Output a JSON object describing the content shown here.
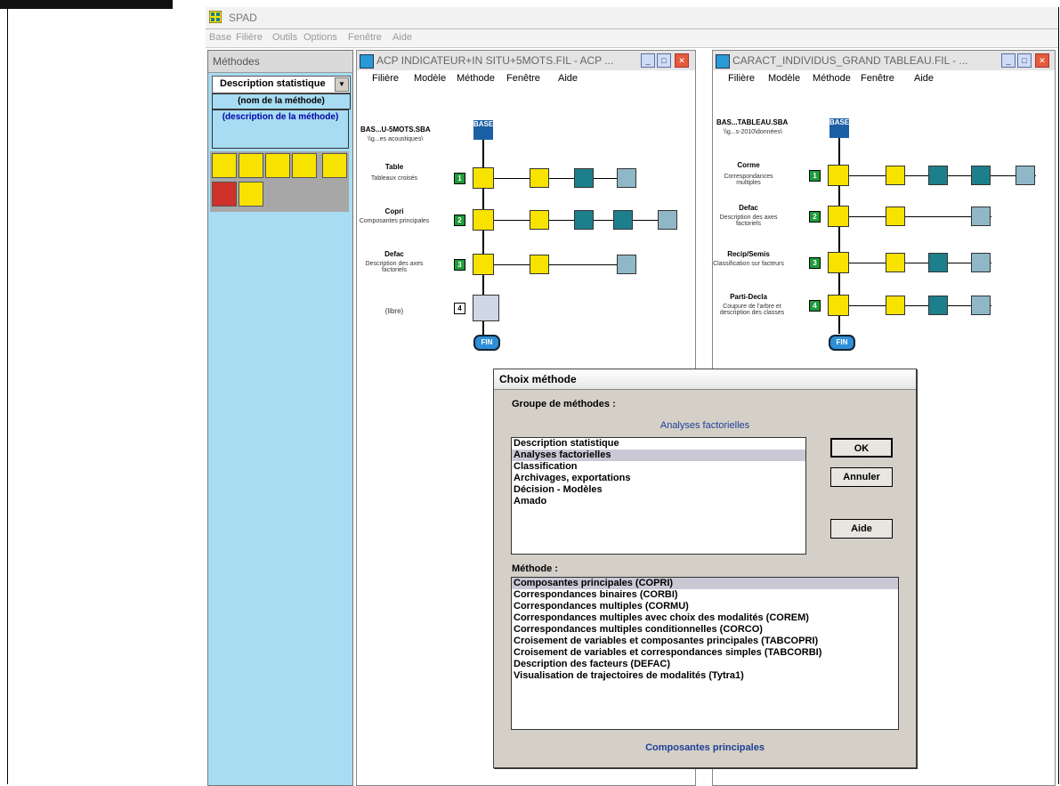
{
  "app": {
    "title": "SPAD"
  },
  "menubar": [
    "Base",
    "Filière",
    "Outils",
    "Options",
    "Fenêtre",
    "Aide"
  ],
  "methods_panel": {
    "title": "Méthodes",
    "combo_value": "Description statistique",
    "method_name": "(nom de la méthode)",
    "method_description": "(description de la méthode)"
  },
  "window1": {
    "title": "ACP INDICATEUR+IN SITU+5MOTS.FIL - ACP ...",
    "menu": [
      "Filière",
      "Modèle",
      "Méthode",
      "Fenêtre",
      "Aide"
    ],
    "base_name": "BAS...U-5MOTS.SBA",
    "base_path": "\\\\g...es acoustiques\\",
    "base_label": "BASE",
    "fin_label": "FIN",
    "steps": [
      {
        "num": "1",
        "name": "Table",
        "desc": "Tableaux croisés"
      },
      {
        "num": "2",
        "name": "Copri",
        "desc": "Composantes principales"
      },
      {
        "num": "3",
        "name": "Defac",
        "desc": "Description des axes factoriels"
      },
      {
        "num": "4",
        "name": "",
        "desc": "(libre)"
      }
    ]
  },
  "window2": {
    "title": "CARACT_INDIVIDUS_GRAND TABLEAU.FIL - ...",
    "menu": [
      "Filière",
      "Modèle",
      "Méthode",
      "Fenêtre",
      "Aide"
    ],
    "base_name": "BAS...TABLEAU.SBA",
    "base_path": "\\\\g...s-2010\\données\\",
    "base_label": "BASE",
    "fin_label": "FIN",
    "steps": [
      {
        "num": "1",
        "name": "Corme",
        "desc": "Correspondances multiples"
      },
      {
        "num": "2",
        "name": "Defac",
        "desc": "Description des axes factoriels"
      },
      {
        "num": "3",
        "name": "Recip/Semis",
        "desc": "Classification sur facteurs"
      },
      {
        "num": "4",
        "name": "Parti-Decla",
        "desc": "Coupure de l'arbre et description des classes"
      }
    ]
  },
  "dialog": {
    "title": "Choix méthode",
    "group_label": "Groupe de méthodes :",
    "group_selected": "Analyses factorielles",
    "groups": [
      "Description statistique",
      "Analyses factorielles",
      "Classification",
      "Archivages, exportations",
      "Décision - Modèles",
      "Amado"
    ],
    "method_label": "Méthode :",
    "methods": [
      "Composantes principales (COPRI)",
      "Correspondances binaires (CORBI)",
      "Correspondances multiples (CORMU)",
      "Correspondances multiples avec choix des modalités (COREM)",
      "Correspondances multiples conditionnelles (CORCO)",
      "Croisement de variables et composantes principales (TABCOPRI)",
      "Croisement de variables et correspondances simples (TABCORBI)",
      "Description des facteurs (DEFAC)",
      "Visualisation de trajectoires de modalités (Tytra1)"
    ],
    "method_selected": "Composantes principales",
    "ok_label": "OK",
    "cancel_label": "Annuler",
    "help_label": "Aide"
  },
  "colors": {
    "panel": "#a7dcf2",
    "node": "#f8e200",
    "accent": "#1e3f95",
    "step_num": "#1e9c3a"
  }
}
